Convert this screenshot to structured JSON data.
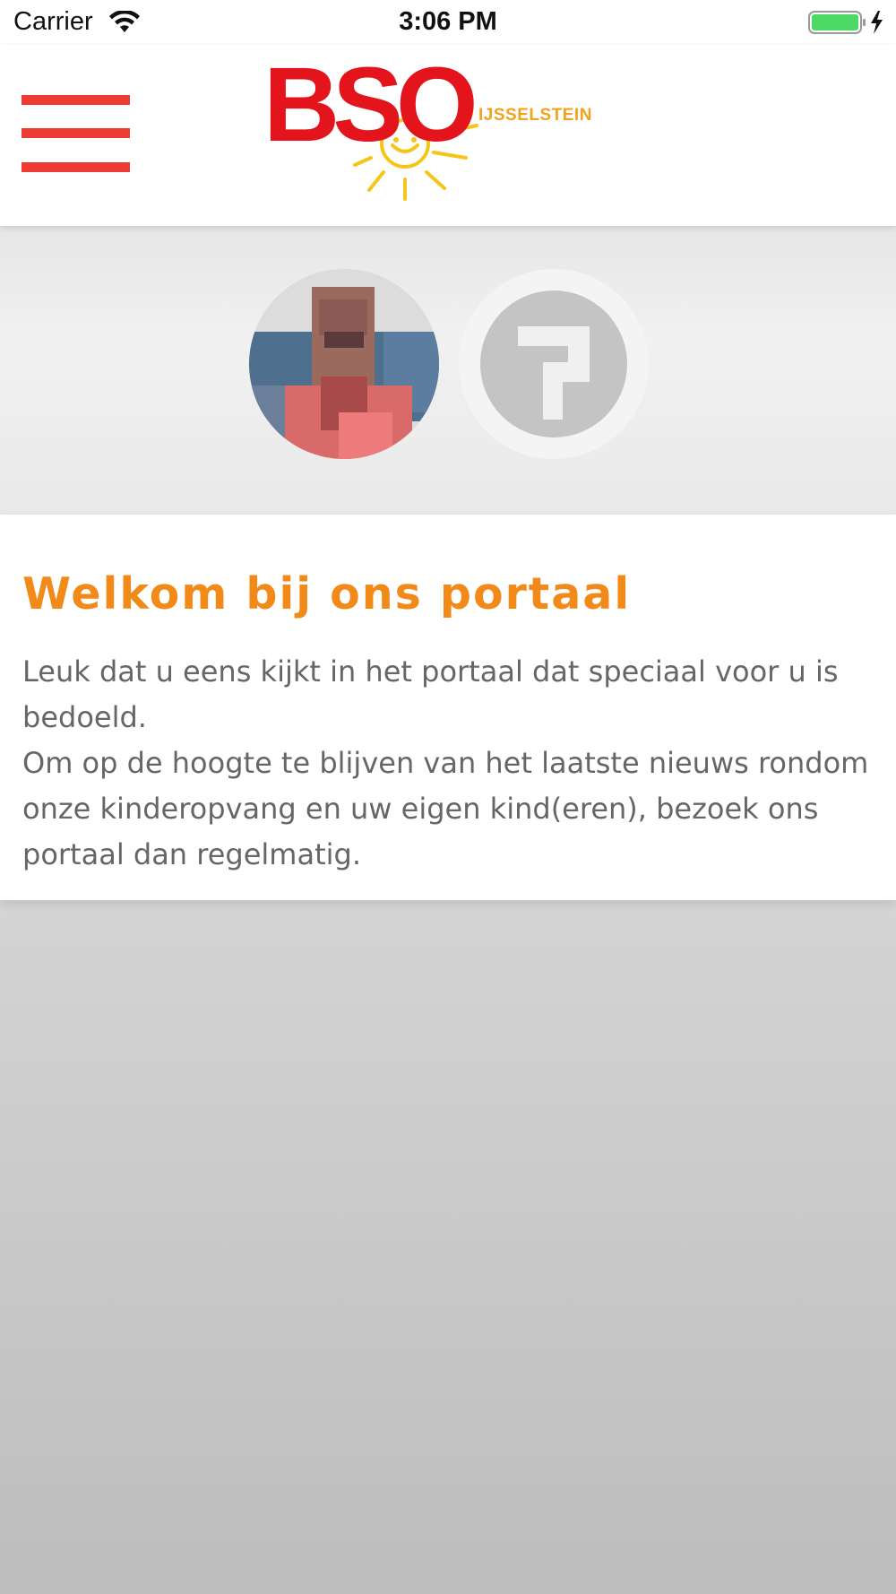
{
  "status_bar": {
    "carrier": "Carrier",
    "time": "3:06 PM",
    "battery_color": "#4cd964"
  },
  "header": {
    "menu_icon": "hamburger-menu-icon",
    "menu_color": "#ec3b32",
    "logo": {
      "main": "BSO",
      "sub": "IJSSELSTEIN"
    }
  },
  "avatars": [
    {
      "name": "child-photo",
      "type": "photo"
    },
    {
      "name": "unknown-person",
      "type": "placeholder"
    }
  ],
  "content": {
    "title": "Welkom bij ons portaal",
    "paragraph_1": "Leuk dat u eens kijkt in het portaal dat speciaal voor u is bedoeld.",
    "paragraph_2": "Om op de hoogte te blijven van het laatste nieuws rondom onze kinderopvang en uw eigen kind(eren), bezoek ons portaal dan regelmatig."
  },
  "colors": {
    "accent_orange": "#f28a1a",
    "brand_red": "#e3141b",
    "text_gray": "#666666"
  }
}
